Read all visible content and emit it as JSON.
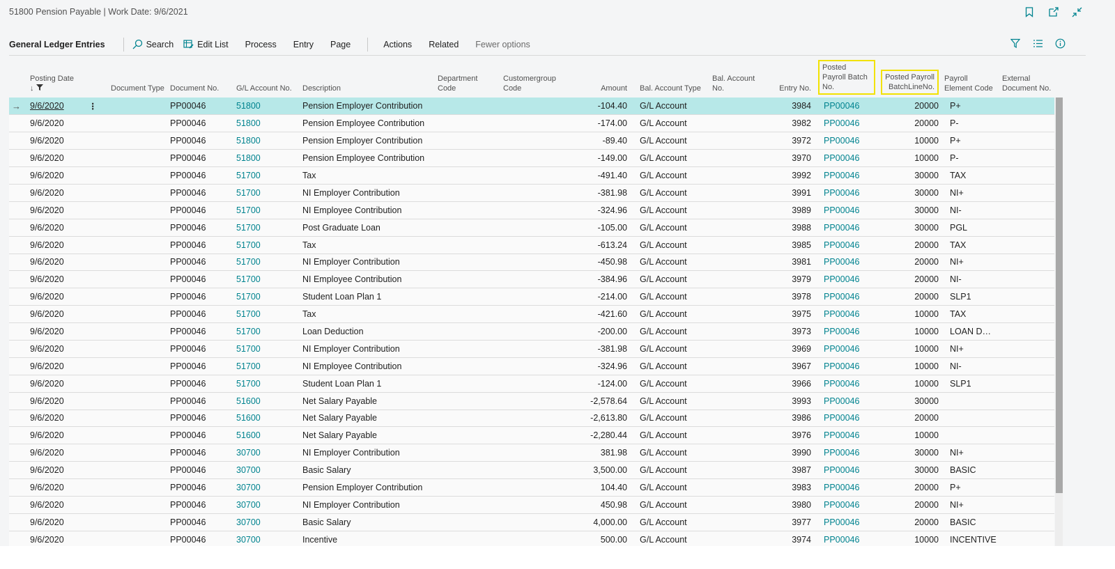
{
  "window": {
    "title": "51800 Pension Payable | Work Date: 9/6/2021",
    "icons": [
      "bookmark-icon",
      "open-new-window-icon",
      "collapse-icon"
    ]
  },
  "actionbar": {
    "title": "General Ledger Entries",
    "search_label": "Search",
    "edit_list_label": "Edit List",
    "process_label": "Process",
    "entry_label": "Entry",
    "page_label": "Page",
    "actions_label": "Actions",
    "related_label": "Related",
    "fewer_options_label": "Fewer options",
    "right_icons": [
      "filter-icon",
      "list-icon",
      "info-icon"
    ]
  },
  "columns": {
    "posting_date": "Posting Date",
    "document_type": "Document Type",
    "document_no": "Document No.",
    "gl_account_no": "G/L Account No.",
    "description": "Description",
    "department_code": "Department Code",
    "customergroup_code": "Customergroup Code",
    "amount": "Amount",
    "bal_account_type": "Bal. Account Type",
    "bal_account_no": "Bal. Account No.",
    "entry_no": "Entry No.",
    "posted_payroll_batch_no": "Posted Payroll Batch No.",
    "posted_payroll_batchline_no": "Posted Payroll BatchLineNo.",
    "payroll_element_code": "Payroll Element Code",
    "external_document_no": "External Document No."
  },
  "rows": [
    {
      "date": "9/6/2020",
      "doc": "PP00046",
      "acct": "51800",
      "desc": "Pension Employer Contribution",
      "amount": "-104.40",
      "bal_type": "G/L Account",
      "entry": "3984",
      "batch": "PP00046",
      "line": "20000",
      "elem": "P+"
    },
    {
      "date": "9/6/2020",
      "doc": "PP00046",
      "acct": "51800",
      "desc": "Pension Employee Contribution",
      "amount": "-174.00",
      "bal_type": "G/L Account",
      "entry": "3982",
      "batch": "PP00046",
      "line": "20000",
      "elem": "P-"
    },
    {
      "date": "9/6/2020",
      "doc": "PP00046",
      "acct": "51800",
      "desc": "Pension Employer Contribution",
      "amount": "-89.40",
      "bal_type": "G/L Account",
      "entry": "3972",
      "batch": "PP00046",
      "line": "10000",
      "elem": "P+"
    },
    {
      "date": "9/6/2020",
      "doc": "PP00046",
      "acct": "51800",
      "desc": "Pension Employee Contribution",
      "amount": "-149.00",
      "bal_type": "G/L Account",
      "entry": "3970",
      "batch": "PP00046",
      "line": "10000",
      "elem": "P-"
    },
    {
      "date": "9/6/2020",
      "doc": "PP00046",
      "acct": "51700",
      "desc": "Tax",
      "amount": "-491.40",
      "bal_type": "G/L Account",
      "entry": "3992",
      "batch": "PP00046",
      "line": "30000",
      "elem": "TAX"
    },
    {
      "date": "9/6/2020",
      "doc": "PP00046",
      "acct": "51700",
      "desc": "NI Employer Contribution",
      "amount": "-381.98",
      "bal_type": "G/L Account",
      "entry": "3991",
      "batch": "PP00046",
      "line": "30000",
      "elem": "NI+"
    },
    {
      "date": "9/6/2020",
      "doc": "PP00046",
      "acct": "51700",
      "desc": "NI Employee Contribution",
      "amount": "-324.96",
      "bal_type": "G/L Account",
      "entry": "3989",
      "batch": "PP00046",
      "line": "30000",
      "elem": "NI-"
    },
    {
      "date": "9/6/2020",
      "doc": "PP00046",
      "acct": "51700",
      "desc": "Post Graduate Loan",
      "amount": "-105.00",
      "bal_type": "G/L Account",
      "entry": "3988",
      "batch": "PP00046",
      "line": "30000",
      "elem": "PGL"
    },
    {
      "date": "9/6/2020",
      "doc": "PP00046",
      "acct": "51700",
      "desc": "Tax",
      "amount": "-613.24",
      "bal_type": "G/L Account",
      "entry": "3985",
      "batch": "PP00046",
      "line": "20000",
      "elem": "TAX"
    },
    {
      "date": "9/6/2020",
      "doc": "PP00046",
      "acct": "51700",
      "desc": "NI Employer Contribution",
      "amount": "-450.98",
      "bal_type": "G/L Account",
      "entry": "3981",
      "batch": "PP00046",
      "line": "20000",
      "elem": "NI+"
    },
    {
      "date": "9/6/2020",
      "doc": "PP00046",
      "acct": "51700",
      "desc": "NI Employee Contribution",
      "amount": "-384.96",
      "bal_type": "G/L Account",
      "entry": "3979",
      "batch": "PP00046",
      "line": "20000",
      "elem": "NI-"
    },
    {
      "date": "9/6/2020",
      "doc": "PP00046",
      "acct": "51700",
      "desc": "Student Loan Plan 1",
      "amount": "-214.00",
      "bal_type": "G/L Account",
      "entry": "3978",
      "batch": "PP00046",
      "line": "20000",
      "elem": "SLP1"
    },
    {
      "date": "9/6/2020",
      "doc": "PP00046",
      "acct": "51700",
      "desc": "Tax",
      "amount": "-421.60",
      "bal_type": "G/L Account",
      "entry": "3975",
      "batch": "PP00046",
      "line": "10000",
      "elem": "TAX"
    },
    {
      "date": "9/6/2020",
      "doc": "PP00046",
      "acct": "51700",
      "desc": "Loan Deduction",
      "amount": "-200.00",
      "bal_type": "G/L Account",
      "entry": "3973",
      "batch": "PP00046",
      "line": "10000",
      "elem": "LOAN DEDU..."
    },
    {
      "date": "9/6/2020",
      "doc": "PP00046",
      "acct": "51700",
      "desc": "NI Employer Contribution",
      "amount": "-381.98",
      "bal_type": "G/L Account",
      "entry": "3969",
      "batch": "PP00046",
      "line": "10000",
      "elem": "NI+"
    },
    {
      "date": "9/6/2020",
      "doc": "PP00046",
      "acct": "51700",
      "desc": "NI Employee Contribution",
      "amount": "-324.96",
      "bal_type": "G/L Account",
      "entry": "3967",
      "batch": "PP00046",
      "line": "10000",
      "elem": "NI-"
    },
    {
      "date": "9/6/2020",
      "doc": "PP00046",
      "acct": "51700",
      "desc": "Student Loan Plan 1",
      "amount": "-124.00",
      "bal_type": "G/L Account",
      "entry": "3966",
      "batch": "PP00046",
      "line": "10000",
      "elem": "SLP1"
    },
    {
      "date": "9/6/2020",
      "doc": "PP00046",
      "acct": "51600",
      "desc": "Net Salary Payable",
      "amount": "-2,578.64",
      "bal_type": "G/L Account",
      "entry": "3993",
      "batch": "PP00046",
      "line": "30000",
      "elem": ""
    },
    {
      "date": "9/6/2020",
      "doc": "PP00046",
      "acct": "51600",
      "desc": "Net Salary Payable",
      "amount": "-2,613.80",
      "bal_type": "G/L Account",
      "entry": "3986",
      "batch": "PP00046",
      "line": "20000",
      "elem": ""
    },
    {
      "date": "9/6/2020",
      "doc": "PP00046",
      "acct": "51600",
      "desc": "Net Salary Payable",
      "amount": "-2,280.44",
      "bal_type": "G/L Account",
      "entry": "3976",
      "batch": "PP00046",
      "line": "10000",
      "elem": ""
    },
    {
      "date": "9/6/2020",
      "doc": "PP00046",
      "acct": "30700",
      "desc": "NI Employer Contribution",
      "amount": "381.98",
      "bal_type": "G/L Account",
      "entry": "3990",
      "batch": "PP00046",
      "line": "30000",
      "elem": "NI+"
    },
    {
      "date": "9/6/2020",
      "doc": "PP00046",
      "acct": "30700",
      "desc": "Basic Salary",
      "amount": "3,500.00",
      "bal_type": "G/L Account",
      "entry": "3987",
      "batch": "PP00046",
      "line": "30000",
      "elem": "BASIC"
    },
    {
      "date": "9/6/2020",
      "doc": "PP00046",
      "acct": "30700",
      "desc": "Pension Employer Contribution",
      "amount": "104.40",
      "bal_type": "G/L Account",
      "entry": "3983",
      "batch": "PP00046",
      "line": "20000",
      "elem": "P+"
    },
    {
      "date": "9/6/2020",
      "doc": "PP00046",
      "acct": "30700",
      "desc": "NI Employer Contribution",
      "amount": "450.98",
      "bal_type": "G/L Account",
      "entry": "3980",
      "batch": "PP00046",
      "line": "20000",
      "elem": "NI+"
    },
    {
      "date": "9/6/2020",
      "doc": "PP00046",
      "acct": "30700",
      "desc": "Basic Salary",
      "amount": "4,000.00",
      "bal_type": "G/L Account",
      "entry": "3977",
      "batch": "PP00046",
      "line": "20000",
      "elem": "BASIC"
    },
    {
      "date": "9/6/2020",
      "doc": "PP00046",
      "acct": "30700",
      "desc": "Incentive",
      "amount": "500.00",
      "bal_type": "G/L Account",
      "entry": "3974",
      "batch": "PP00046",
      "line": "10000",
      "elem": "INCENTIVE"
    }
  ],
  "colors": {
    "accent": "#00838f",
    "selected_row": "#b7e8e8",
    "highlight_box": "#f2e200"
  }
}
